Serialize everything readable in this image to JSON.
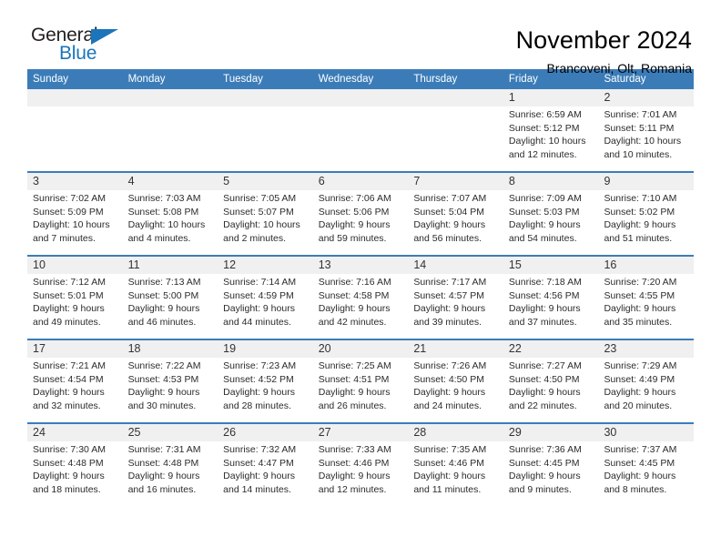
{
  "brand": {
    "name_part1": "General",
    "name_part2": "Blue",
    "triangle_icon": "triangle-icon",
    "color_dark": "#231f20",
    "color_blue": "#1b75bb"
  },
  "header": {
    "title": "November 2024",
    "subtitle": "Brancoveni, Olt, Romania"
  },
  "theme": {
    "header_blue": "#3b7cb8",
    "date_band_gray": "#f0f0f0",
    "cell_white": "#ffffff"
  },
  "weekdays": [
    "Sunday",
    "Monday",
    "Tuesday",
    "Wednesday",
    "Thursday",
    "Friday",
    "Saturday"
  ],
  "weeks": [
    {
      "days": [
        {
          "date": "",
          "lines": [
            "",
            "",
            "",
            ""
          ]
        },
        {
          "date": "",
          "lines": [
            "",
            "",
            "",
            ""
          ]
        },
        {
          "date": "",
          "lines": [
            "",
            "",
            "",
            ""
          ]
        },
        {
          "date": "",
          "lines": [
            "",
            "",
            "",
            ""
          ]
        },
        {
          "date": "",
          "lines": [
            "",
            "",
            "",
            ""
          ]
        },
        {
          "date": "1",
          "lines": [
            "Sunrise: 6:59 AM",
            "Sunset: 5:12 PM",
            "Daylight: 10 hours",
            "and 12 minutes."
          ]
        },
        {
          "date": "2",
          "lines": [
            "Sunrise: 7:01 AM",
            "Sunset: 5:11 PM",
            "Daylight: 10 hours",
            "and 10 minutes."
          ]
        }
      ]
    },
    {
      "days": [
        {
          "date": "3",
          "lines": [
            "Sunrise: 7:02 AM",
            "Sunset: 5:09 PM",
            "Daylight: 10 hours",
            "and 7 minutes."
          ]
        },
        {
          "date": "4",
          "lines": [
            "Sunrise: 7:03 AM",
            "Sunset: 5:08 PM",
            "Daylight: 10 hours",
            "and 4 minutes."
          ]
        },
        {
          "date": "5",
          "lines": [
            "Sunrise: 7:05 AM",
            "Sunset: 5:07 PM",
            "Daylight: 10 hours",
            "and 2 minutes."
          ]
        },
        {
          "date": "6",
          "lines": [
            "Sunrise: 7:06 AM",
            "Sunset: 5:06 PM",
            "Daylight: 9 hours",
            "and 59 minutes."
          ]
        },
        {
          "date": "7",
          "lines": [
            "Sunrise: 7:07 AM",
            "Sunset: 5:04 PM",
            "Daylight: 9 hours",
            "and 56 minutes."
          ]
        },
        {
          "date": "8",
          "lines": [
            "Sunrise: 7:09 AM",
            "Sunset: 5:03 PM",
            "Daylight: 9 hours",
            "and 54 minutes."
          ]
        },
        {
          "date": "9",
          "lines": [
            "Sunrise: 7:10 AM",
            "Sunset: 5:02 PM",
            "Daylight: 9 hours",
            "and 51 minutes."
          ]
        }
      ]
    },
    {
      "days": [
        {
          "date": "10",
          "lines": [
            "Sunrise: 7:12 AM",
            "Sunset: 5:01 PM",
            "Daylight: 9 hours",
            "and 49 minutes."
          ]
        },
        {
          "date": "11",
          "lines": [
            "Sunrise: 7:13 AM",
            "Sunset: 5:00 PM",
            "Daylight: 9 hours",
            "and 46 minutes."
          ]
        },
        {
          "date": "12",
          "lines": [
            "Sunrise: 7:14 AM",
            "Sunset: 4:59 PM",
            "Daylight: 9 hours",
            "and 44 minutes."
          ]
        },
        {
          "date": "13",
          "lines": [
            "Sunrise: 7:16 AM",
            "Sunset: 4:58 PM",
            "Daylight: 9 hours",
            "and 42 minutes."
          ]
        },
        {
          "date": "14",
          "lines": [
            "Sunrise: 7:17 AM",
            "Sunset: 4:57 PM",
            "Daylight: 9 hours",
            "and 39 minutes."
          ]
        },
        {
          "date": "15",
          "lines": [
            "Sunrise: 7:18 AM",
            "Sunset: 4:56 PM",
            "Daylight: 9 hours",
            "and 37 minutes."
          ]
        },
        {
          "date": "16",
          "lines": [
            "Sunrise: 7:20 AM",
            "Sunset: 4:55 PM",
            "Daylight: 9 hours",
            "and 35 minutes."
          ]
        }
      ]
    },
    {
      "days": [
        {
          "date": "17",
          "lines": [
            "Sunrise: 7:21 AM",
            "Sunset: 4:54 PM",
            "Daylight: 9 hours",
            "and 32 minutes."
          ]
        },
        {
          "date": "18",
          "lines": [
            "Sunrise: 7:22 AM",
            "Sunset: 4:53 PM",
            "Daylight: 9 hours",
            "and 30 minutes."
          ]
        },
        {
          "date": "19",
          "lines": [
            "Sunrise: 7:23 AM",
            "Sunset: 4:52 PM",
            "Daylight: 9 hours",
            "and 28 minutes."
          ]
        },
        {
          "date": "20",
          "lines": [
            "Sunrise: 7:25 AM",
            "Sunset: 4:51 PM",
            "Daylight: 9 hours",
            "and 26 minutes."
          ]
        },
        {
          "date": "21",
          "lines": [
            "Sunrise: 7:26 AM",
            "Sunset: 4:50 PM",
            "Daylight: 9 hours",
            "and 24 minutes."
          ]
        },
        {
          "date": "22",
          "lines": [
            "Sunrise: 7:27 AM",
            "Sunset: 4:50 PM",
            "Daylight: 9 hours",
            "and 22 minutes."
          ]
        },
        {
          "date": "23",
          "lines": [
            "Sunrise: 7:29 AM",
            "Sunset: 4:49 PM",
            "Daylight: 9 hours",
            "and 20 minutes."
          ]
        }
      ]
    },
    {
      "days": [
        {
          "date": "24",
          "lines": [
            "Sunrise: 7:30 AM",
            "Sunset: 4:48 PM",
            "Daylight: 9 hours",
            "and 18 minutes."
          ]
        },
        {
          "date": "25",
          "lines": [
            "Sunrise: 7:31 AM",
            "Sunset: 4:48 PM",
            "Daylight: 9 hours",
            "and 16 minutes."
          ]
        },
        {
          "date": "26",
          "lines": [
            "Sunrise: 7:32 AM",
            "Sunset: 4:47 PM",
            "Daylight: 9 hours",
            "and 14 minutes."
          ]
        },
        {
          "date": "27",
          "lines": [
            "Sunrise: 7:33 AM",
            "Sunset: 4:46 PM",
            "Daylight: 9 hours",
            "and 12 minutes."
          ]
        },
        {
          "date": "28",
          "lines": [
            "Sunrise: 7:35 AM",
            "Sunset: 4:46 PM",
            "Daylight: 9 hours",
            "and 11 minutes."
          ]
        },
        {
          "date": "29",
          "lines": [
            "Sunrise: 7:36 AM",
            "Sunset: 4:45 PM",
            "Daylight: 9 hours",
            "and 9 minutes."
          ]
        },
        {
          "date": "30",
          "lines": [
            "Sunrise: 7:37 AM",
            "Sunset: 4:45 PM",
            "Daylight: 9 hours",
            "and 8 minutes."
          ]
        }
      ]
    }
  ]
}
